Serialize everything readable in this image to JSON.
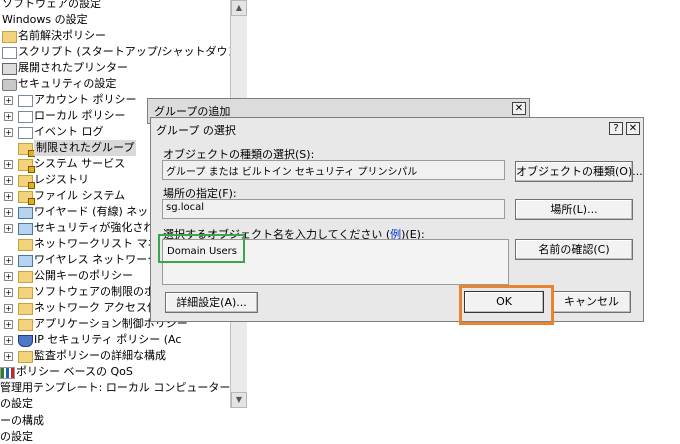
{
  "tree": {
    "items": [
      {
        "label": "ソフトウェアの設定"
      },
      {
        "label": "Windows の設定"
      },
      {
        "label": "名前解決ポリシー"
      },
      {
        "label": "スクリプト (スタートアップ/シャットダウン)"
      },
      {
        "label": "展開されたプリンター"
      },
      {
        "label": "セキュリティの設定"
      },
      {
        "label": "アカウント ポリシー"
      },
      {
        "label": "ローカル ポリシー"
      },
      {
        "label": "イベント ログ"
      },
      {
        "label": "制限されたグループ"
      },
      {
        "label": "システム サービス"
      },
      {
        "label": "レジストリ"
      },
      {
        "label": "ファイル システム"
      },
      {
        "label": "ワイヤード (有線) ネットワーク"
      },
      {
        "label": "セキュリティが強化された W"
      },
      {
        "label": "ネットワークリスト マネージャ"
      },
      {
        "label": "ワイヤレス ネットワーク (IEE"
      },
      {
        "label": "公開キーのポリシー"
      },
      {
        "label": "ソフトウェアの制限のポリシー"
      },
      {
        "label": "ネットワーク アクセス保護"
      },
      {
        "label": "アプリケーション制御ポリシー"
      },
      {
        "label": "IP セキュリティ ポリシー (Ac"
      },
      {
        "label": "監査ポリシーの詳細な構成"
      },
      {
        "label": "ポリシー ベースの QoS"
      },
      {
        "label": "管理用テンプレート: ローカル コンピューターから取得し"
      },
      {
        "label": "の設定"
      },
      {
        "label": "ーの構成"
      },
      {
        "label": "の設定"
      }
    ]
  },
  "outer_dialog": {
    "title": "グループの追加",
    "close_glyph": "✕"
  },
  "dialog": {
    "title": "グループ の選択",
    "help_glyph": "?",
    "close_glyph": "✕",
    "object_type_label": "オブジェクトの種類の選択(S):",
    "object_type_value": "グループ または ビルトイン セキュリティ プリンシパル",
    "object_type_button": "オブジェクトの種類(O)...",
    "location_label": "場所の指定(F):",
    "location_value": "sg.local",
    "location_button": "場所(L)...",
    "enter_names_label_a": "選択するオブジェクト名を入力してください (",
    "enter_names_link": "例",
    "enter_names_label_b": ")(E):",
    "names_value": "Domain Users",
    "check_names_button": "名前の確認(C)",
    "advanced_button": "詳細設定(A)...",
    "ok_button": "OK",
    "cancel_button": "キャンセル"
  },
  "colors": {
    "highlight_green": "#3aa84a",
    "highlight_orange": "#e8842c",
    "dialog_bg": "#e8e8e8"
  }
}
